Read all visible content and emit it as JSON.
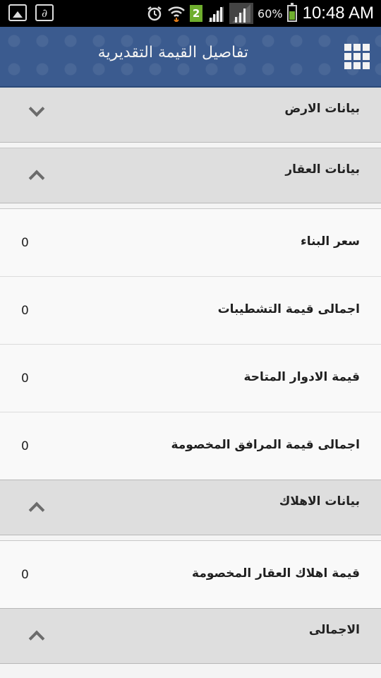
{
  "status_bar": {
    "network_badge": "2",
    "battery_percent": "60%",
    "time": "10:48 AM",
    "icons": [
      "gallery-icon",
      "signature-icon",
      "alarm-icon",
      "wifi-icon",
      "signal-icon",
      "signal-icon",
      "battery-icon"
    ]
  },
  "app_bar": {
    "title": "تفاصيل القيمة التقديرية",
    "menu_icon": "grid-menu-icon"
  },
  "sections": [
    {
      "label": "بيانات الارض",
      "expanded": false,
      "rows": []
    },
    {
      "label": "بيانات العقار",
      "expanded": true,
      "rows": [
        {
          "label": "سعر البناء",
          "value": "0"
        },
        {
          "label": "اجمالى قيمة التشطيبات",
          "value": "0"
        },
        {
          "label": "قيمة الادوار المتاحة",
          "value": "0"
        },
        {
          "label": "اجمالى قيمة المرافق المخصومة",
          "value": "0"
        }
      ]
    },
    {
      "label": "بيانات الاهلاك",
      "expanded": true,
      "rows": [
        {
          "label": "قيمة اهلاك العقار المخصومة",
          "value": "0"
        }
      ]
    },
    {
      "label": "الاجمالى",
      "expanded": true,
      "rows": []
    }
  ],
  "colors": {
    "app_bar": "#3b5b8f",
    "section_header": "#dedede",
    "row_bg": "#f9f9f9"
  }
}
